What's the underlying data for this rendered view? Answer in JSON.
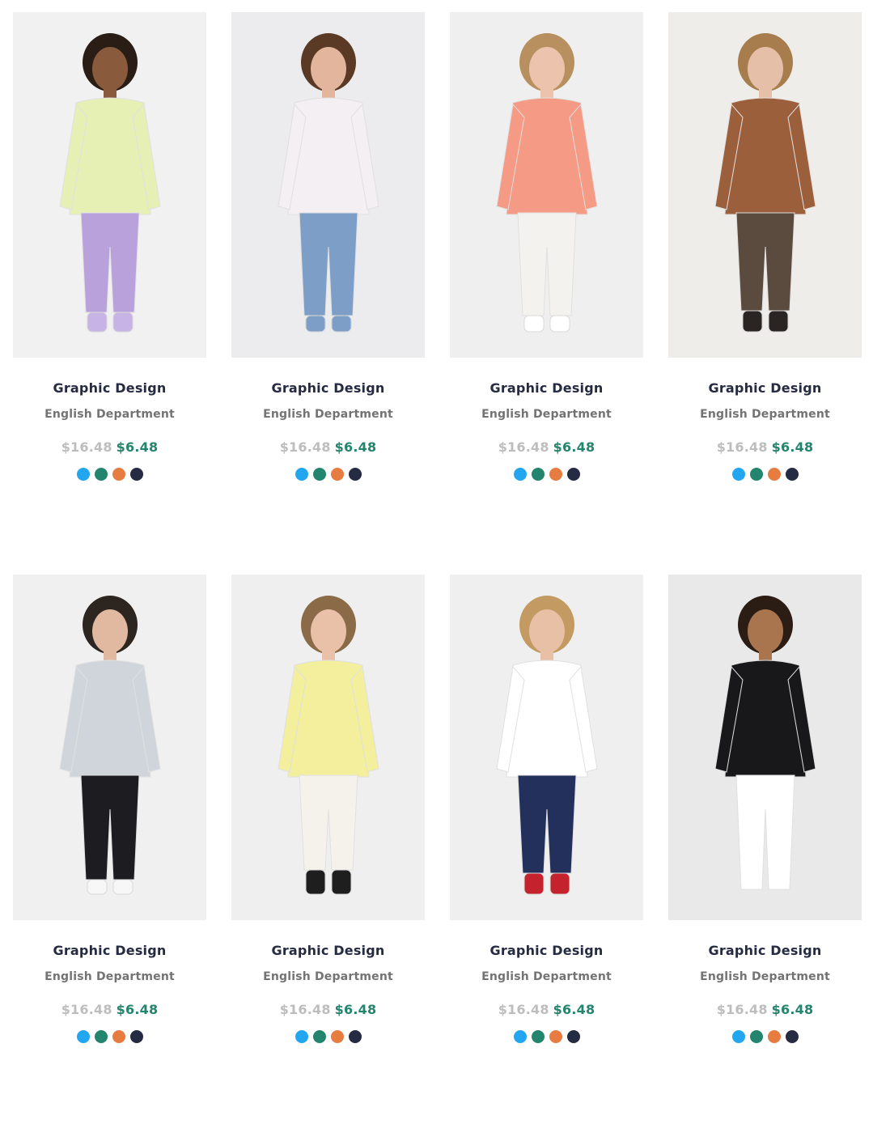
{
  "products": [
    {
      "title": "Graphic Design",
      "department": "English Department",
      "old_price": "$16.48",
      "new_price": "$6.48",
      "image_icon": "woman-lime-turtleneck-lilac-shorts-photo",
      "photo": {
        "bg": "#f1f1f1",
        "skin": "#8a5a3c",
        "hair": "#2a1d15",
        "top": "#e7f0b4",
        "bottom": "#b9a2dc",
        "shoes": "#c7b3e6",
        "shoes_h": 24
      }
    },
    {
      "title": "Graphic Design",
      "department": "English Department",
      "old_price": "$16.48",
      "new_price": "$6.48",
      "image_icon": "man-printed-tshirt-denim-jacket-photo",
      "photo": {
        "bg": "#ececee",
        "skin": "#e2b59c",
        "hair": "#5a3a25",
        "top": "#f3eff3",
        "bottom": "#7d9fc7",
        "shoes": "#7d9fc7",
        "shoes_h": 20
      }
    },
    {
      "title": "Graphic Design",
      "department": "English Department",
      "old_price": "$16.48",
      "new_price": "$6.48",
      "image_icon": "woman-coral-top-white-jeans-photo",
      "photo": {
        "bg": "#efefef",
        "skin": "#ecc3ad",
        "hair": "#b8905f",
        "top": "#f49a85",
        "bottom": "#f4f2ee",
        "shoes": "#ffffff",
        "shoes_h": 20
      }
    },
    {
      "title": "Graphic Design",
      "department": "English Department",
      "old_price": "$16.48",
      "new_price": "$6.48",
      "image_icon": "woman-brown-jacket-print-skirt-photo",
      "photo": {
        "bg": "#efedea",
        "skin": "#e6bfa8",
        "hair": "#a87d4e",
        "top": "#9c5f3c",
        "bottom": "#5b4a3e",
        "shoes": "#2a2522",
        "shoes_h": 26
      }
    },
    {
      "title": "Graphic Design",
      "department": "English Department",
      "old_price": "$16.48",
      "new_price": "$6.48",
      "image_icon": "man-grey-parka-black-trousers-photo",
      "photo": {
        "bg": "#f0f0f0",
        "skin": "#e0b9a0",
        "hair": "#2c2520",
        "top": "#cfd5da",
        "bottom": "#1d1d21",
        "shoes": "#f7f7f7",
        "shoes_h": 18
      }
    },
    {
      "title": "Graphic Design",
      "department": "English Department",
      "old_price": "$16.48",
      "new_price": "$6.48",
      "image_icon": "woman-yellow-cardigan-white-trousers-photo",
      "photo": {
        "bg": "#efefef",
        "skin": "#e9c1a9",
        "hair": "#8b6a48",
        "top": "#f3ef9d",
        "bottom": "#f5f2ec",
        "shoes": "#1e1e1e",
        "shoes_h": 30
      }
    },
    {
      "title": "Graphic Design",
      "department": "English Department",
      "old_price": "$16.48",
      "new_price": "$6.48",
      "image_icon": "man-colorblock-hoodie-navy-joggers-photo",
      "photo": {
        "bg": "#efefef",
        "skin": "#e7c0a6",
        "hair": "#c39a62",
        "top": "#ffffff",
        "bottom": "#22305b",
        "shoes": "#c4222c",
        "shoes_h": 26
      }
    },
    {
      "title": "Graphic Design",
      "department": "English Department",
      "old_price": "$16.48",
      "new_price": "$6.48",
      "image_icon": "man-black-graphic-tshirt-photo",
      "photo": {
        "bg": "#e9e9ea",
        "skin": "#a9754f",
        "hair": "#2b1d14",
        "top": "#18181b",
        "bottom": "#ffffff",
        "shoes": "#ffffff",
        "shoes_h": 0
      }
    }
  ],
  "swatch_colors": [
    {
      "name": "blue",
      "hex": "#23a6f0"
    },
    {
      "name": "green",
      "hex": "#23856d"
    },
    {
      "name": "orange",
      "hex": "#e77c40"
    },
    {
      "name": "navy",
      "hex": "#252b42"
    }
  ]
}
